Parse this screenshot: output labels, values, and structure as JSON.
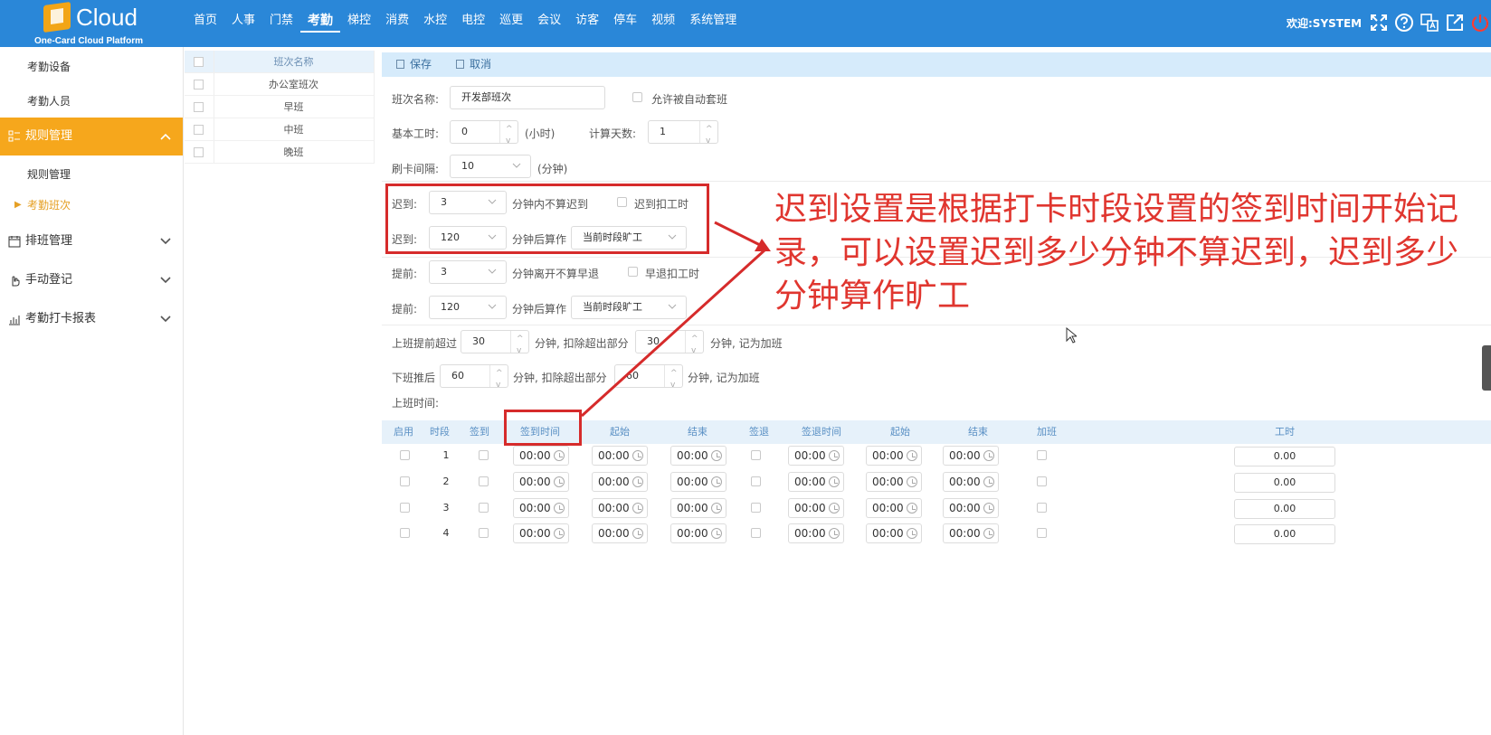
{
  "header": {
    "logo_text": "Cloud",
    "logo_sub": "One-Card Cloud Platform",
    "nav": [
      "首页",
      "人事",
      "门禁",
      "考勤",
      "梯控",
      "消费",
      "水控",
      "电控",
      "巡更",
      "会议",
      "访客",
      "停车",
      "视频",
      "系统管理"
    ],
    "active_nav": "考勤",
    "welcome": "欢迎:SYSTEM",
    "icons": [
      "fullscreen-icon",
      "help-icon",
      "language-icon",
      "external-link-icon",
      "power-icon"
    ]
  },
  "sidebar": {
    "items": [
      {
        "label": "考勤设备"
      },
      {
        "label": "考勤人员"
      },
      {
        "label": "规则管理"
      },
      {
        "label": "规则管理"
      },
      {
        "label": "考勤班次"
      },
      {
        "label": "排班管理"
      },
      {
        "label": "手动登记"
      },
      {
        "label": "考勤打卡报表"
      }
    ]
  },
  "shift_list": {
    "header": "班次名称",
    "rows": [
      "办公室班次",
      "早班",
      "中班",
      "晚班"
    ]
  },
  "toolbar": {
    "save": "保存",
    "cancel": "取消"
  },
  "form": {
    "shift_name_label": "班次名称:",
    "shift_name_value": "开发部班次",
    "auto_assign_label": "允许被自动套班",
    "base_hours_label": "基本工时:",
    "base_hours_value": "0",
    "hours_unit": "(小时)",
    "calc_days_label": "计算天数:",
    "calc_days_value": "1",
    "swipe_interval_label": "刷卡间隔:",
    "swipe_interval_value": "10",
    "minutes_unit": "(分钟)",
    "late1_label": "迟到:",
    "late1_value": "3",
    "late1_text": "分钟内不算迟到",
    "late_deduct_label": "迟到扣工时",
    "late2_label": "迟到:",
    "late2_value": "120",
    "late2_text": "分钟后算作",
    "late2_select": "当前时段旷工",
    "early1_label": "提前:",
    "early1_value": "3",
    "early1_text": "分钟离开不算早退",
    "early_deduct_label": "早退扣工时",
    "early2_label": "提前:",
    "early2_value": "120",
    "early2_text": "分钟后算作",
    "early2_select": "当前时段旷工",
    "ot_before_label": "上班提前超过",
    "ot_before_value": "30",
    "ot_before_mid": "分钟, 扣除超出部分",
    "ot_before_deduct": "30",
    "ot_before_tail": "分钟, 记为加班",
    "ot_after_label": "下班推后",
    "ot_after_value": "60",
    "ot_after_mid": "分钟, 扣除超出部分",
    "ot_after_deduct": "60",
    "ot_after_tail": "分钟, 记为加班",
    "work_time_label": "上班时间:"
  },
  "time_table": {
    "headers": [
      "启用",
      "时段",
      "签到",
      "签到时间",
      "起始",
      "结束",
      "签退",
      "签退时间",
      "起始",
      "结束",
      "加班",
      "工时"
    ],
    "rows": [
      {
        "no": "1",
        "t1": "00:00",
        "t2": "00:00",
        "t3": "00:00",
        "t4": "00:00",
        "t5": "00:00",
        "t6": "00:00",
        "hours": "0.00"
      },
      {
        "no": "2",
        "t1": "00:00",
        "t2": "00:00",
        "t3": "00:00",
        "t4": "00:00",
        "t5": "00:00",
        "t6": "00:00",
        "hours": "0.00"
      },
      {
        "no": "3",
        "t1": "00:00",
        "t2": "00:00",
        "t3": "00:00",
        "t4": "00:00",
        "t5": "00:00",
        "t6": "00:00",
        "hours": "0.00"
      },
      {
        "no": "4",
        "t1": "00:00",
        "t2": "00:00",
        "t3": "00:00",
        "t4": "00:00",
        "t5": "00:00",
        "t6": "00:00",
        "hours": "0.00"
      }
    ]
  },
  "annotation": {
    "text": "迟到设置是根据打卡时段设置的签到时间开始记录，可以设置迟到多少分钟不算迟到，迟到多少分钟算作旷工"
  },
  "colors": {
    "topbar": "#2a87d8",
    "active_menu": "#f6a71c",
    "annotation_red": "#d62b2b"
  }
}
